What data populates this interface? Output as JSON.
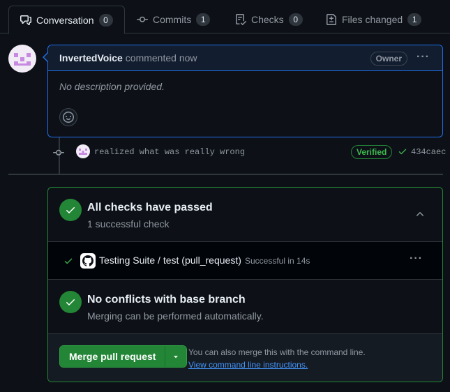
{
  "tabs": [
    {
      "label": "Conversation",
      "count": "0",
      "icon": "comment-discussion-icon"
    },
    {
      "label": "Commits",
      "count": "1",
      "icon": "git-commit-icon"
    },
    {
      "label": "Checks",
      "count": "0",
      "icon": "checklist-icon"
    },
    {
      "label": "Files changed",
      "count": "1",
      "icon": "file-diff-icon"
    }
  ],
  "comment": {
    "author": "InvertedVoice",
    "action": "commented now",
    "role_badge": "Owner",
    "body": "No description provided.",
    "menu_label": "···"
  },
  "commit": {
    "message": "realized what was really wrong",
    "verified_badge": "Verified",
    "sha": "434caec"
  },
  "checks": {
    "title": "All checks have passed",
    "subtitle": "1 successful check",
    "row_name": "Testing Suite / test (pull_request)",
    "row_status": "Successful in 14s",
    "row_menu": "···"
  },
  "conflicts": {
    "title": "No conflicts with base branch",
    "subtitle": "Merging can be performed automatically."
  },
  "merge": {
    "button_label": "Merge pull request",
    "hint": "You can also merge this with the command line.",
    "link": "View command line instructions."
  },
  "colors": {
    "accent_blue": "#1f6feb",
    "success_green": "#238636",
    "link_blue": "#4493f8"
  }
}
